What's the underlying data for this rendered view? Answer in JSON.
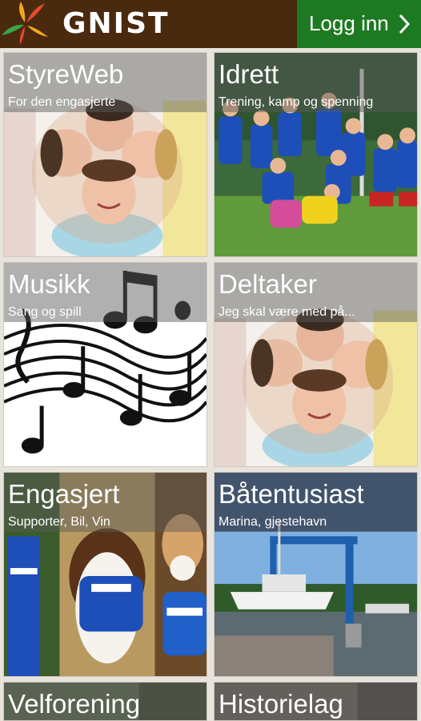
{
  "header": {
    "logo_text": "GNIST",
    "login_label": "Logg inn",
    "colors": {
      "bar": "#4a2a0f",
      "login": "#1e7a22"
    }
  },
  "tiles": [
    {
      "title": "StyreWeb",
      "subtitle": "For den engasjerte",
      "image": "faces-circle"
    },
    {
      "title": "Idrett",
      "subtitle": "Trening, kamp og spenning",
      "image": "kids-football-team"
    },
    {
      "title": "Musikk",
      "subtitle": "Sang og spill",
      "image": "music-notes"
    },
    {
      "title": "Deltaker",
      "subtitle": "Jeg skal være med på...",
      "image": "faces-circle"
    },
    {
      "title": "Engasjert",
      "subtitle": "Supporter, Bil, Vin",
      "image": "dogs-with-scarves"
    },
    {
      "title": "Båtentusiast",
      "subtitle": "Marina, gjestehavn",
      "image": "marina-boat-lift"
    },
    {
      "title": "Velforening",
      "subtitle": "",
      "image": "neighborhood"
    },
    {
      "title": "Historielag",
      "subtitle": "",
      "image": "history"
    }
  ]
}
